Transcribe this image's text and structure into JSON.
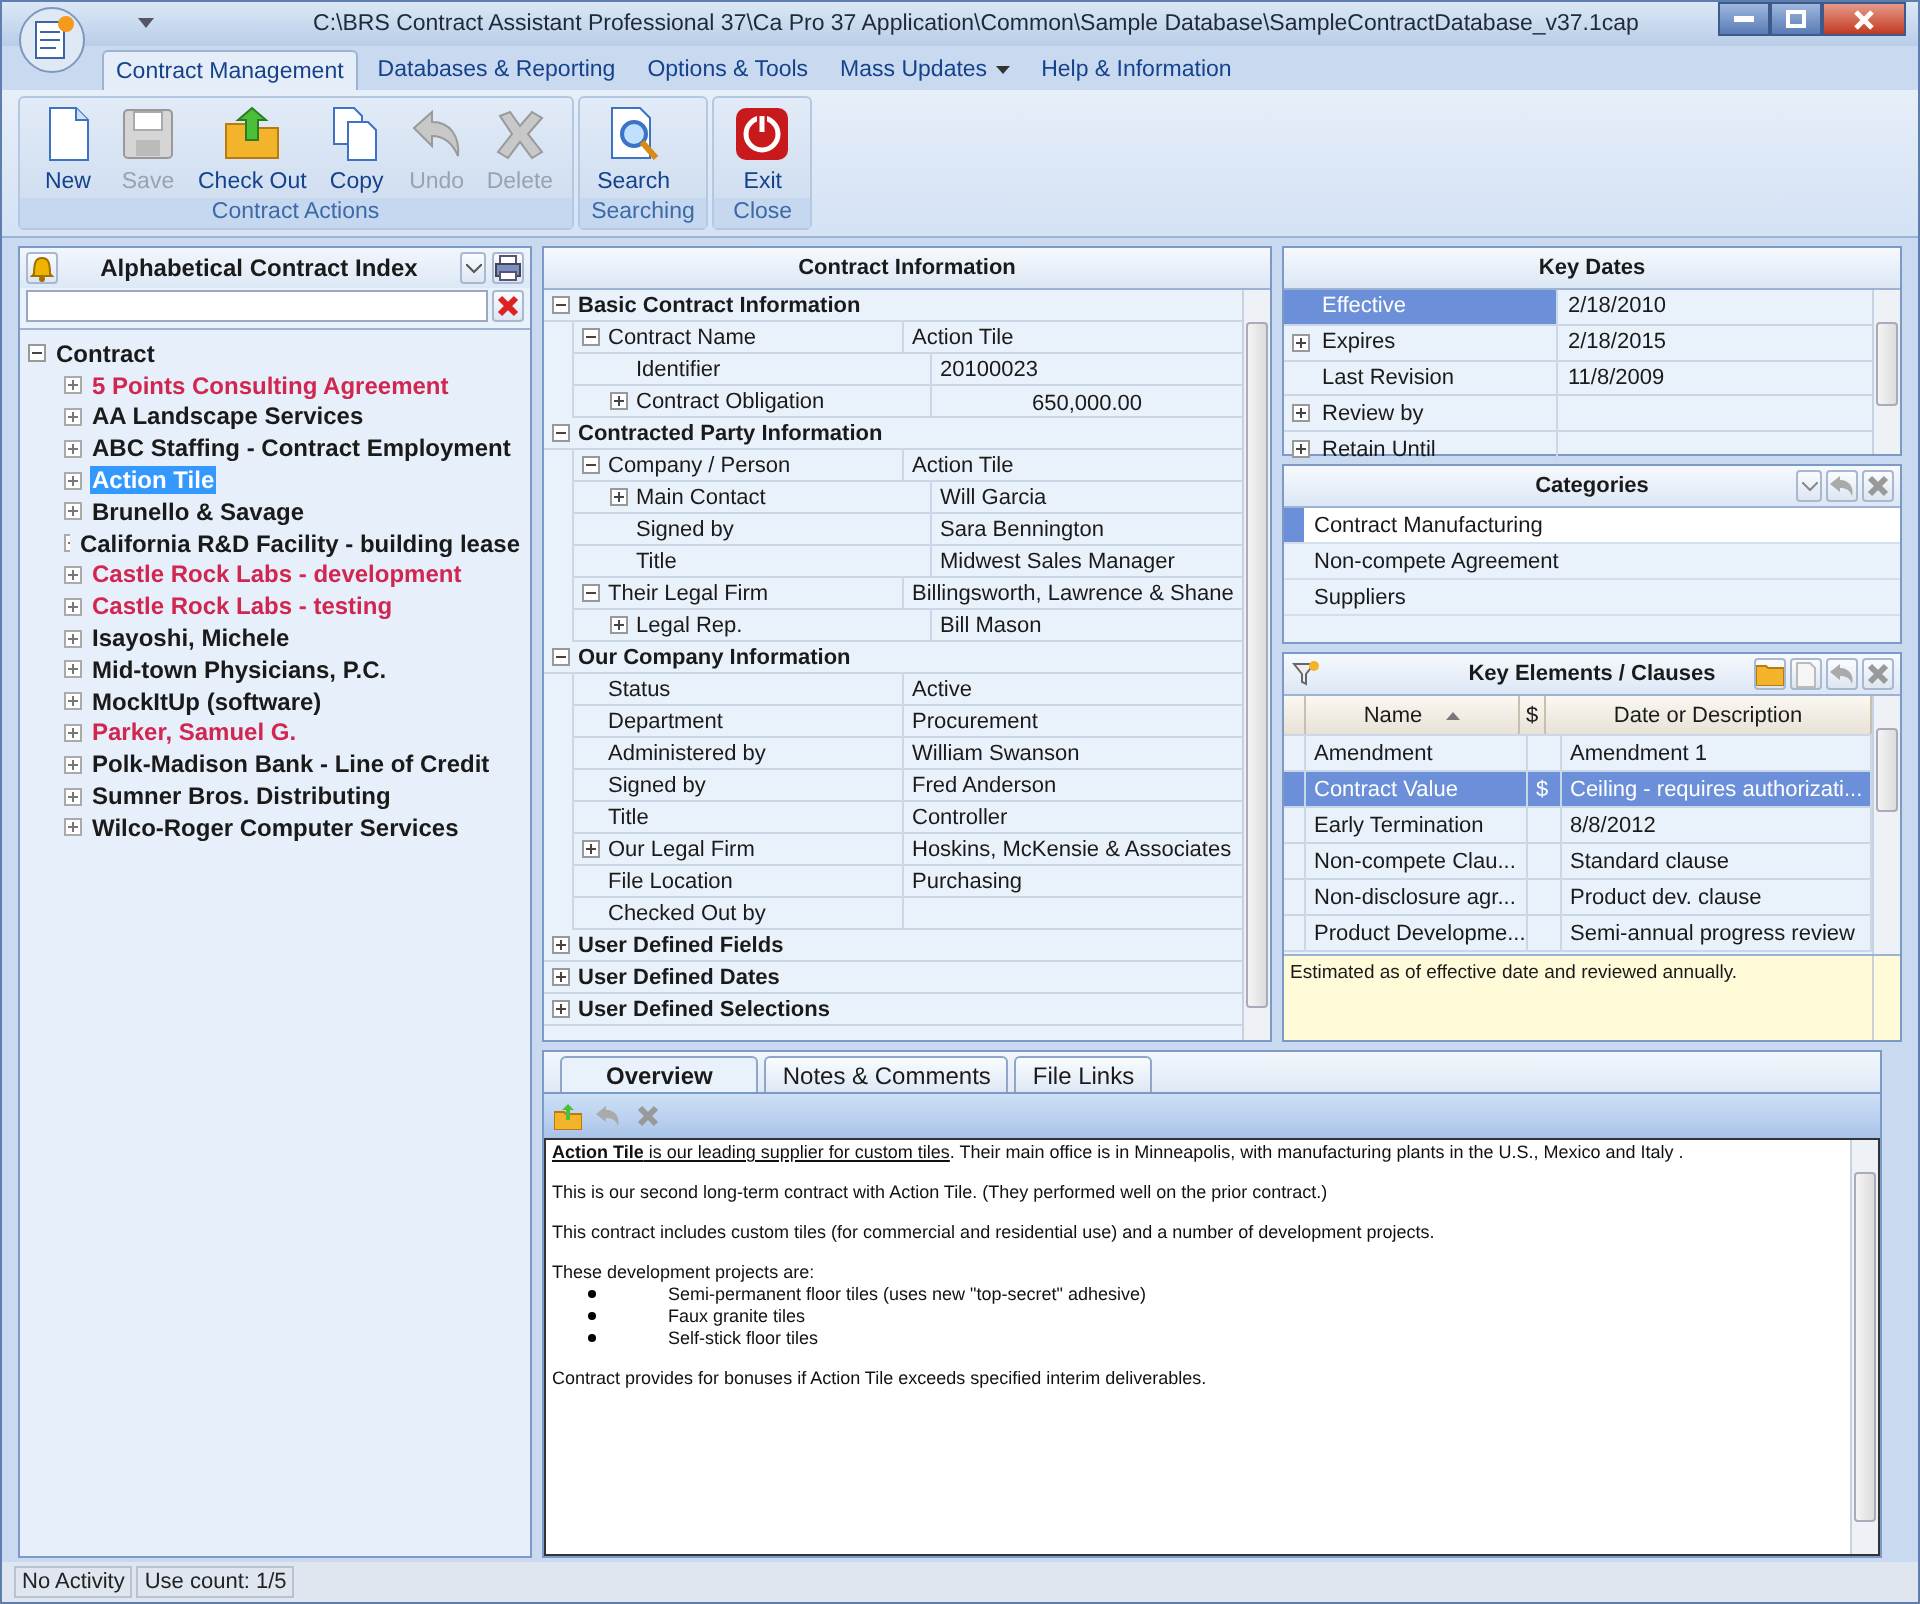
{
  "window": {
    "title": "C:\\BRS Contract Assistant Professional 37\\Ca Pro 37 Application\\Common\\Sample Database\\SampleContractDatabase_v37.1cap"
  },
  "ribbon_tabs": [
    {
      "label": "Contract Management",
      "selected": true,
      "has_menu": false
    },
    {
      "label": "Databases & Reporting",
      "selected": false,
      "has_menu": false
    },
    {
      "label": "Options & Tools",
      "selected": false,
      "has_menu": false
    },
    {
      "label": "Mass Updates",
      "selected": false,
      "has_menu": true
    },
    {
      "label": "Help & Information",
      "selected": false,
      "has_menu": false
    }
  ],
  "ribbon_groups": [
    {
      "label": "Contract Actions",
      "buttons": [
        {
          "label": "New",
          "kind": "new",
          "disabled": false
        },
        {
          "label": "Save",
          "kind": "save",
          "disabled": true
        },
        {
          "label": "Check Out",
          "kind": "checkout",
          "disabled": false
        },
        {
          "label": "Copy",
          "kind": "copy",
          "disabled": false
        },
        {
          "label": "Undo",
          "kind": "undo",
          "disabled": true
        },
        {
          "label": "Delete",
          "kind": "delete",
          "disabled": true
        }
      ]
    },
    {
      "label": "Searching",
      "buttons": [
        {
          "label": "Search",
          "kind": "search",
          "disabled": false
        }
      ]
    },
    {
      "label": "Close",
      "buttons": [
        {
          "label": "Exit",
          "kind": "exit",
          "disabled": false
        }
      ]
    }
  ],
  "index": {
    "title": "Alphabetical Contract Index",
    "tree": {
      "label": "Contract",
      "expanded": true,
      "children": [
        {
          "label": "5 Points Consulting Agreement",
          "color": "#d0264f",
          "selected": false
        },
        {
          "label": "AA Landscape Services",
          "color": "#1a1a1a",
          "selected": false
        },
        {
          "label": "ABC Staffing - Contract Employment",
          "color": "#1a1a1a",
          "selected": false
        },
        {
          "label": "Action Tile",
          "selected": true
        },
        {
          "label": "Brunello & Savage",
          "color": "#1a1a1a",
          "selected": false
        },
        {
          "label": "California R&D Facility - building lease",
          "color": "#1a1a1a",
          "selected": false
        },
        {
          "label": "Castle Rock Labs - development",
          "color": "#d0264f",
          "selected": false
        },
        {
          "label": "Castle Rock Labs - testing",
          "color": "#d0264f",
          "selected": false
        },
        {
          "label": "Isayoshi, Michele",
          "color": "#1a1a1a",
          "selected": false
        },
        {
          "label": "Mid-town Physicians, P.C.",
          "color": "#1a1a1a",
          "selected": false
        },
        {
          "label": "MockItUp (software)",
          "color": "#1a1a1a",
          "selected": false
        },
        {
          "label": "Parker, Samuel G.",
          "color": "#d0264f",
          "selected": false
        },
        {
          "label": "Polk-Madison Bank - Line of Credit",
          "color": "#1a1a1a",
          "selected": false
        },
        {
          "label": "Sumner Bros. Distributing",
          "color": "#1a1a1a",
          "selected": false
        },
        {
          "label": "Wilco-Roger Computer Services",
          "color": "#1a1a1a",
          "selected": false
        }
      ]
    }
  },
  "contract_info": {
    "title": "Contract Information",
    "sections": [
      {
        "label": "Basic Contract Information",
        "expanded": true,
        "rows": [
          {
            "label": "Contract Name",
            "value": "Action Tile",
            "expanded": true,
            "children": [
              {
                "label": "Identifier",
                "value": "20100023",
                "kind": "text"
              },
              {
                "label": "Contract Obligation",
                "value": "650,000.00",
                "kind": "amount",
                "expanded": false
              }
            ]
          }
        ]
      },
      {
        "label": "Contracted Party Information",
        "expanded": true,
        "rows": [
          {
            "label": "Company / Person",
            "value": "Action Tile",
            "expanded": true,
            "children": [
              {
                "label": "Main Contact",
                "value": "Will Garcia",
                "expanded": false
              },
              {
                "label": "Signed by",
                "value": "Sara Bennington"
              },
              {
                "label": "Title",
                "value": "Midwest Sales Manager"
              }
            ]
          },
          {
            "label": "Their Legal Firm",
            "value": "Billingsworth, Lawrence & Shane",
            "expanded": true,
            "children": [
              {
                "label": "Legal Rep.",
                "value": "Bill Mason",
                "expanded": false
              }
            ]
          }
        ]
      },
      {
        "label": "Our Company Information",
        "expanded": true,
        "rows": [
          {
            "label": "Status",
            "value": "Active"
          },
          {
            "label": "Department",
            "value": "Procurement"
          },
          {
            "label": "Administered by",
            "value": "William Swanson"
          },
          {
            "label": "Signed by",
            "value": "Fred Anderson"
          },
          {
            "label": "Title",
            "value": "Controller"
          },
          {
            "label": "Our Legal Firm",
            "value": "Hoskins, McKensie & Associates",
            "expanded": false
          },
          {
            "label": "File Location",
            "value": "Purchasing"
          },
          {
            "label": "Checked Out by"
          }
        ]
      },
      {
        "label": "User Defined Fields",
        "expanded": false
      },
      {
        "label": "User Defined Dates",
        "expanded": false
      },
      {
        "label": "User Defined Selections",
        "expanded": false
      }
    ]
  },
  "key_dates": {
    "title": "Key Dates",
    "rows": [
      {
        "label": "Effective",
        "value": "2/18/2010",
        "expandable": false,
        "selected": true
      },
      {
        "label": "Expires",
        "value": "2/18/2015",
        "expandable": true,
        "selected": false
      },
      {
        "label": "Last Revision",
        "value": "11/8/2009",
        "expandable": false,
        "selected": false
      },
      {
        "label": "Review by",
        "expandable": true,
        "selected": false
      },
      {
        "label": "Retain Until",
        "expandable": true,
        "selected": false
      }
    ]
  },
  "categories": {
    "title": "Categories",
    "items": [
      {
        "label": "Contract Manufacturing",
        "selected": true
      },
      {
        "label": "Non-compete Agreement",
        "selected": false
      },
      {
        "label": "Suppliers",
        "selected": false
      }
    ]
  },
  "clauses": {
    "title": "Key Elements / Clauses",
    "columns": [
      "Name",
      "$",
      "Date or Description"
    ],
    "rows": [
      {
        "name": "Amendment",
        "dollar": "",
        "description": "Amendment 1",
        "selected": false
      },
      {
        "name": "Contract Value",
        "dollar": "$",
        "description": "Ceiling - requires authorizati...",
        "selected": true
      },
      {
        "name": "Early Termination",
        "dollar": "",
        "description": "8/8/2012",
        "selected": false
      },
      {
        "name": "Non-compete Clau...",
        "dollar": "",
        "description": "Standard clause",
        "selected": false
      },
      {
        "name": "Non-disclosure agr...",
        "dollar": "",
        "description": "Product dev. clause",
        "selected": false
      },
      {
        "name": "Product Developme...",
        "dollar": "",
        "description": "Semi-annual progress review",
        "selected": false
      }
    ],
    "note": "Estimated as of effective date and reviewed annually."
  },
  "notes": {
    "tabs": [
      {
        "label": "Overview",
        "selected": true
      },
      {
        "label": "Notes & Comments",
        "selected": false
      },
      {
        "label": "File Links",
        "selected": false
      }
    ],
    "blocks": [
      {
        "kind": "paragraph",
        "link": "**Action Tile** is our leading supplier for custom tiles",
        "text": ". Their main office is in Minneapolis, with manufacturing plants in the U.S., Mexico and Italy ."
      },
      {
        "kind": "paragraph",
        "text": "This is our second long-term contract with Action Tile. (They performed well on the prior contract.)"
      },
      {
        "kind": "paragraph",
        "text": "This contract includes custom tiles (for commercial and residential use) and a number of development projects."
      },
      {
        "kind": "bullets",
        "text": "These development projects are:",
        "items": [
          "Semi-permanent floor tiles (uses new \"top-secret\" adhesive)",
          "Faux granite tiles",
          "Self-stick floor tiles"
        ]
      },
      {
        "kind": "paragraph",
        "text": "Contract provides for bonuses if Action Tile exceeds specified interim deliverables."
      }
    ]
  },
  "status_bar": [
    "No Activity",
    "Use count: 1/5"
  ]
}
